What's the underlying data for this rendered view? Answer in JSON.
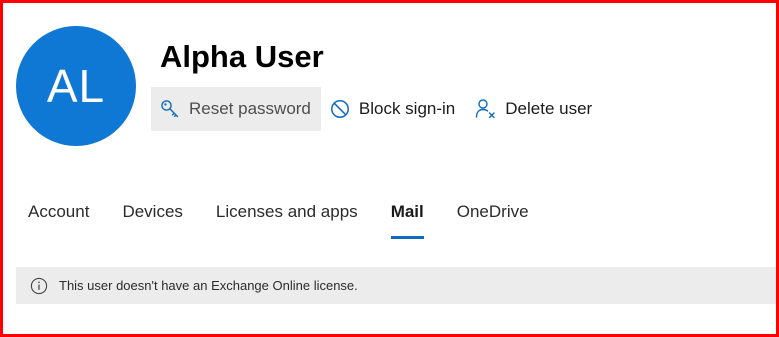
{
  "user": {
    "initials": "AL",
    "display_name": "Alpha User",
    "avatar_color": "#0f78d4"
  },
  "toolbar": {
    "reset_password_label": "Reset password",
    "block_signin_label": "Block sign-in",
    "delete_user_label": "Delete user",
    "icons": {
      "reset_password": "key-icon",
      "block_signin": "block-icon",
      "delete_user": "person-delete-icon"
    }
  },
  "tabs": [
    {
      "label": "Account"
    },
    {
      "label": "Devices"
    },
    {
      "label": "Licenses and apps"
    },
    {
      "label": "Mail",
      "active": true
    },
    {
      "label": "OneDrive"
    }
  ],
  "notice": {
    "icon": "info-icon",
    "message": "This user doesn't have an Exchange Online license."
  },
  "colors": {
    "accent": "#0f6cbd",
    "frame_border": "#ff0000",
    "notice_background": "#ececec"
  }
}
